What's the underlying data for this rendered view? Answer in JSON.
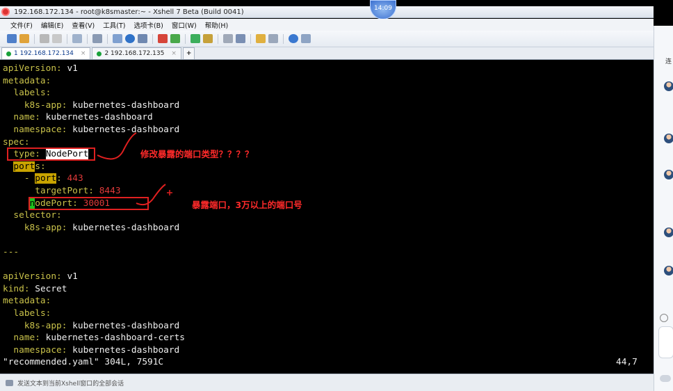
{
  "window": {
    "title": "192.168.172.134 - root@k8smaster:~ - Xshell 7 Beta (Build 0041)",
    "clock": "14:09"
  },
  "menu": [
    "文件(F)",
    "编辑(E)",
    "查看(V)",
    "工具(T)",
    "选项卡(B)",
    "窗口(W)",
    "帮助(H)"
  ],
  "tabs": [
    {
      "label": "1 192.168.172.134",
      "active": true
    },
    {
      "label": "2 192.168.172.135",
      "active": false
    }
  ],
  "terminal": {
    "status_file": "\"recommended.yaml\" 304L, 7591C",
    "cursor_pos": "44,7"
  },
  "annotations": {
    "type_note": "修改暴露的端口类型？？？？",
    "nodeport_note": "暴露端口，3万以上的端口号"
  },
  "statusbar": {
    "hint": "发送文本到当前Xshell窗口的全部会话"
  },
  "side_panel": {
    "label": "连"
  }
}
